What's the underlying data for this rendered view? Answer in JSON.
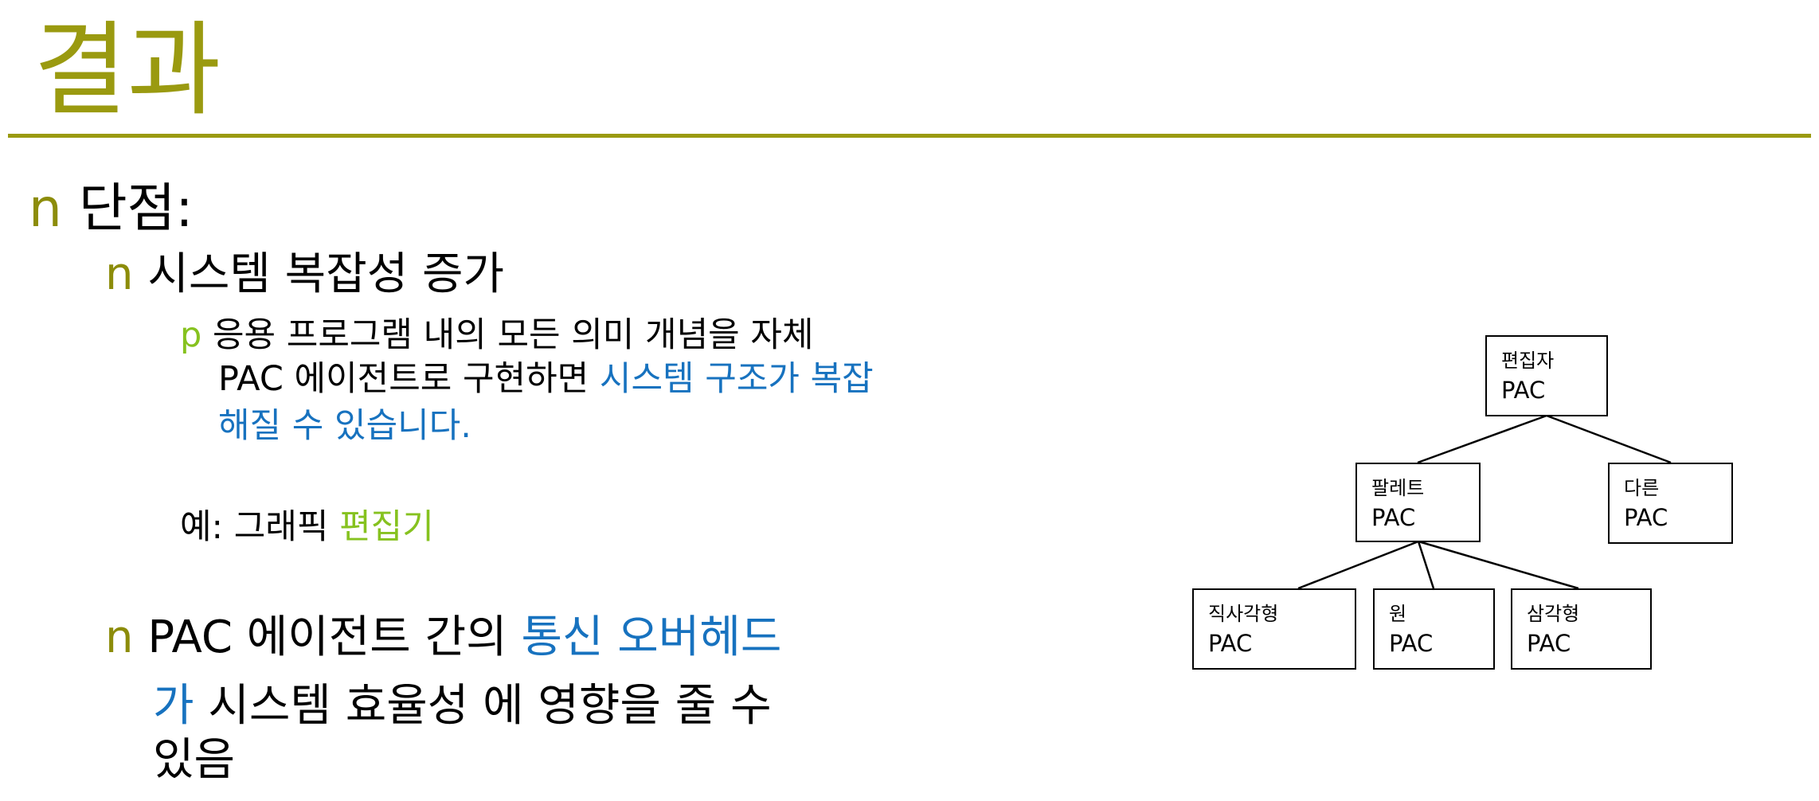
{
  "slide": {
    "title": "결과"
  },
  "content": {
    "bullet_n": "n",
    "bullet_p": "p",
    "item1_label": "단점:",
    "item1_1_label": "시스템 복잡성 증가",
    "item1_1_1_text_a": "응용 프로그램 내의 모든 의미 개념을 자체",
    "item1_1_1_text_b": "PAC 에이전트로 구현하면",
    "item1_1_1_text_c": "시스템 구조가 복잡",
    "item1_1_1_text_d": "해질 수 있습니다.",
    "example_prefix": "예: 그래픽",
    "example_highlight": "편집기",
    "item1_2_text_a": "PAC 에이전트 간의",
    "item1_2_text_b": "통신 오버헤드",
    "item1_2_text_c": "가",
    "item1_2_text_d": "시스템 효율성 에 영향을 줄 수",
    "item1_2_text_e": "있음"
  },
  "diagram": {
    "nodes": [
      {
        "id": "editor",
        "label": "편집자",
        "sub": "PAC"
      },
      {
        "id": "palette",
        "label": "팔레트",
        "sub": "PAC"
      },
      {
        "id": "other",
        "label": "다른",
        "sub": "PAC"
      },
      {
        "id": "rectangle",
        "label": "직사각형",
        "sub": "PAC"
      },
      {
        "id": "circle",
        "label": "원",
        "sub": "PAC"
      },
      {
        "id": "triangle",
        "label": "삼각형",
        "sub": "PAC"
      }
    ]
  },
  "colors": {
    "title": "#9a9a10",
    "bullet": "#8c8c0a",
    "highlight_blue": "#1772bf",
    "highlight_green": "#86c21f"
  }
}
